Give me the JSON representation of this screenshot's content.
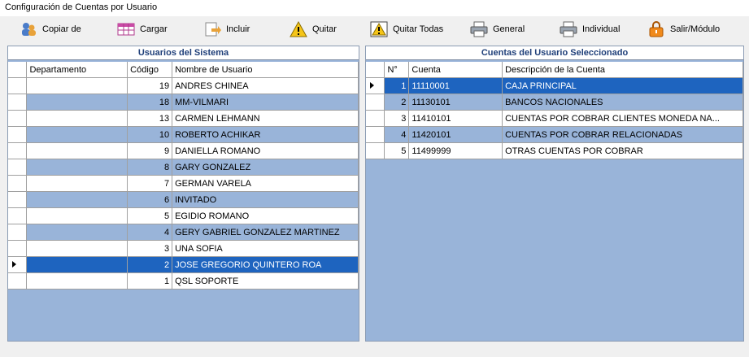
{
  "window": {
    "title": "Configuración de Cuentas por Usuario"
  },
  "toolbar": {
    "copiar": "Copiar de",
    "cargar": "Cargar",
    "incluir": "Incluir",
    "quitar": "Quitar",
    "quitar_todas": "Quitar Todas",
    "general": "General",
    "individual": "Individual",
    "salir": "Salir/Módulo"
  },
  "users_panel": {
    "title": "Usuarios del Sistema",
    "columns": [
      "Departamento",
      "Código",
      "Nombre de Usuario"
    ],
    "rows": [
      {
        "dept": "",
        "code": "19",
        "name": "ANDRES CHINEA"
      },
      {
        "dept": "",
        "code": "18",
        "name": "MM-VILMARI"
      },
      {
        "dept": "",
        "code": "13",
        "name": "CARMEN LEHMANN"
      },
      {
        "dept": "",
        "code": "10",
        "name": "ROBERTO ACHIKAR"
      },
      {
        "dept": "",
        "code": "9",
        "name": "DANIELLA ROMANO"
      },
      {
        "dept": "",
        "code": "8",
        "name": "GARY GONZALEZ"
      },
      {
        "dept": "",
        "code": "7",
        "name": "GERMAN VARELA"
      },
      {
        "dept": "",
        "code": "6",
        "name": "INVITADO"
      },
      {
        "dept": "",
        "code": "5",
        "name": "EGIDIO ROMANO"
      },
      {
        "dept": "",
        "code": "4",
        "name": "GERY GABRIEL GONZALEZ MARTINEZ"
      },
      {
        "dept": "",
        "code": "3",
        "name": "UNA SOFIA"
      },
      {
        "dept": "",
        "code": "2",
        "name": "JOSE GREGORIO QUINTERO ROA"
      },
      {
        "dept": "",
        "code": "1",
        "name": "QSL SOPORTE"
      }
    ],
    "selected_index": 11
  },
  "accounts_panel": {
    "title": "Cuentas del Usuario Seleccionado",
    "columns": [
      "N°",
      "Cuenta",
      "Descripción de la Cuenta"
    ],
    "rows": [
      {
        "n": "1",
        "cuenta": "11110001",
        "desc": "CAJA PRINCIPAL"
      },
      {
        "n": "2",
        "cuenta": "11130101",
        "desc": "BANCOS NACIONALES"
      },
      {
        "n": "3",
        "cuenta": "11410101",
        "desc": "CUENTAS POR COBRAR CLIENTES MONEDA NA..."
      },
      {
        "n": "4",
        "cuenta": "11420101",
        "desc": "CUENTAS POR COBRAR RELACIONADAS"
      },
      {
        "n": "5",
        "cuenta": "11499999",
        "desc": "OTRAS CUENTAS POR COBRAR"
      }
    ],
    "selected_index": 0
  },
  "colors": {
    "selected_row": "#1e64bf",
    "alt_row": "#99b4d9",
    "header_text": "#1f3f79"
  }
}
